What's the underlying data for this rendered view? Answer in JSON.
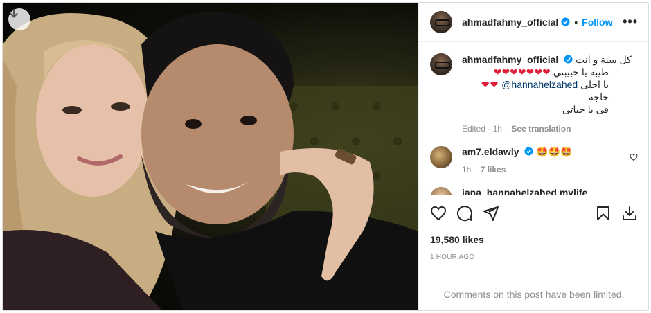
{
  "post": {
    "author": "ahmadfahmy_official",
    "follow_label": "Follow",
    "dot": "•",
    "more": "•••"
  },
  "caption": {
    "author": "ahmadfahmy_official",
    "line1": "كل سنة و انت",
    "line2": "طيبة يا حبيبتي",
    "hearts_line2": "❤❤❤❤❤❤❤",
    "line3_text": "يا احلى حاجة",
    "mention": "@hannahelzahed",
    "hearts_line3": "❤❤",
    "line4": "فى يا حياتى",
    "edited": "Edited · 1h",
    "see_translation": "See translation"
  },
  "comments": [
    {
      "user": "am7.eldawly",
      "text": "🤩🤩🤩",
      "time": "1h",
      "likes": "7 likes"
    },
    {
      "user": "jana_hannahelzahed.mylife",
      "text": "",
      "time": "",
      "likes": ""
    }
  ],
  "likes_count": "19,580 likes",
  "posted_time": "1 HOUR AGO",
  "limited_notice": "Comments on this post have been limited.",
  "colors": {
    "accent": "#0095f6",
    "heart": "#ed4956",
    "muted": "#8e8e8e"
  },
  "icons": [
    "download-icon",
    "verified-icon",
    "heart-icon",
    "comment-icon",
    "share-icon",
    "bookmark-icon",
    "save-download-icon"
  ]
}
